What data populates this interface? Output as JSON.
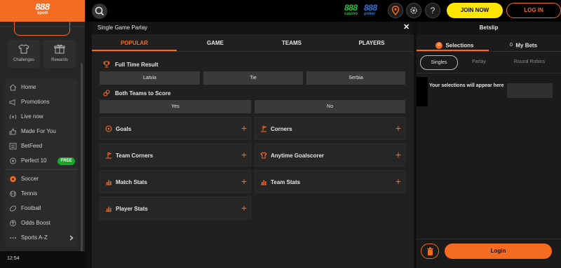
{
  "brand": {
    "logo": "888",
    "logo_sub": "sport",
    "accent": "#f36c21"
  },
  "header": {
    "casino_num": "888",
    "casino_label": "casino",
    "poker_num": "888",
    "poker_label": "poker",
    "join_label": "JOIN NOW",
    "login_label": "LOG IN",
    "help_label": "?",
    "icons": [
      "search-icon",
      "location-pin-icon",
      "gear-icon",
      "help-icon"
    ]
  },
  "sidebar": {
    "tiles": [
      {
        "label": "Challenges",
        "icon": "shirt-icon"
      },
      {
        "label": "Rewards",
        "icon": "gift-icon"
      }
    ],
    "nav": [
      {
        "label": "Home",
        "icon": "home-icon"
      },
      {
        "label": "Promotions",
        "icon": "megaphone-icon"
      },
      {
        "label": "Live now",
        "icon": "live-icon"
      },
      {
        "label": "Made For You",
        "icon": "thumbs-up-icon"
      },
      {
        "label": "BetFeed",
        "icon": "feed-icon"
      },
      {
        "label": "Perfect 10",
        "icon": "target-icon",
        "badge": "FREE"
      }
    ],
    "sports": [
      {
        "label": "Soccer",
        "icon": "soccer-ball-icon"
      },
      {
        "label": "Tennis",
        "icon": "tennis-ball-icon"
      },
      {
        "label": "Football",
        "icon": "football-icon"
      },
      {
        "label": "Odds Boost",
        "icon": "boost-icon"
      },
      {
        "label": "Sports A-Z",
        "icon": "dots-icon"
      }
    ],
    "clock": "12:54"
  },
  "parlay": {
    "title": "Single Game Parlay",
    "close": "✕",
    "tabs": [
      "POPULAR",
      "GAME",
      "TEAMS",
      "PLAYERS"
    ],
    "full_time": {
      "title": "Full Time Result",
      "options": [
        "Latvia",
        "Tie",
        "Serbia"
      ]
    },
    "btts": {
      "title": "Both Teams to Score",
      "options": [
        "Yes",
        "No"
      ]
    },
    "markets": [
      {
        "label": "Goals",
        "icon": "ball-icon"
      },
      {
        "label": "Corners",
        "icon": "corner-flag-icon"
      },
      {
        "label": "Team Corners",
        "icon": "corner-flag-icon"
      },
      {
        "label": "Anytime Goalscorer",
        "icon": "shirt-icon"
      },
      {
        "label": "Match Stats",
        "icon": "stats-icon"
      },
      {
        "label": "Team Stats",
        "icon": "stats-icon"
      },
      {
        "label": "Player Stats",
        "icon": "stats-icon"
      }
    ],
    "plus": "+"
  },
  "betslip": {
    "title": "Betslip",
    "tabs": [
      {
        "count": "0",
        "label": "Selections"
      },
      {
        "count": "0",
        "label": "My Bets"
      }
    ],
    "modes": [
      "Singles",
      "Parlay",
      "Round Robins"
    ],
    "empty_message": "Your selections will appear here",
    "login_label": "Login"
  }
}
